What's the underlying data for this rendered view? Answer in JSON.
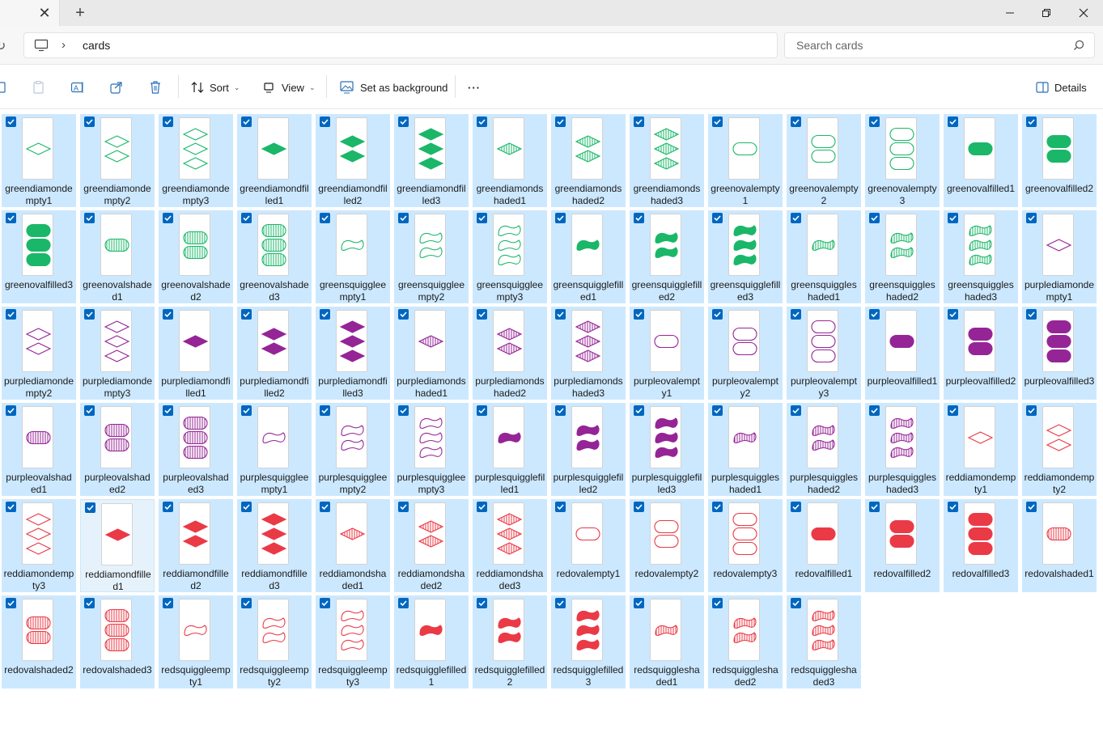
{
  "window": {
    "new_tab_label": "+"
  },
  "address": {
    "crumb": "cards",
    "search_placeholder": "Search cards"
  },
  "toolbar": {
    "sort_label": "Sort",
    "view_label": "View",
    "background_label": "Set as background",
    "more_label": "···",
    "details_label": "Details"
  },
  "colors": {
    "green": "#1bb769",
    "purple": "#952596",
    "red": "#ea3a46",
    "selection": "#cce8ff",
    "checkbox": "#0067c0"
  },
  "files": [
    {
      "name": "greendiamondempty1",
      "color": "green",
      "shape": "diamond",
      "fill": "empty",
      "count": 1
    },
    {
      "name": "greendiamondempty2",
      "color": "green",
      "shape": "diamond",
      "fill": "empty",
      "count": 2
    },
    {
      "name": "greendiamondempty3",
      "color": "green",
      "shape": "diamond",
      "fill": "empty",
      "count": 3
    },
    {
      "name": "greendiamondfilled1",
      "color": "green",
      "shape": "diamond",
      "fill": "filled",
      "count": 1
    },
    {
      "name": "greendiamondfilled2",
      "color": "green",
      "shape": "diamond",
      "fill": "filled",
      "count": 2
    },
    {
      "name": "greendiamondfilled3",
      "color": "green",
      "shape": "diamond",
      "fill": "filled",
      "count": 3
    },
    {
      "name": "greendiamondshaded1",
      "color": "green",
      "shape": "diamond",
      "fill": "shaded",
      "count": 1
    },
    {
      "name": "greendiamondshaded2",
      "color": "green",
      "shape": "diamond",
      "fill": "shaded",
      "count": 2
    },
    {
      "name": "greendiamondshaded3",
      "color": "green",
      "shape": "diamond",
      "fill": "shaded",
      "count": 3
    },
    {
      "name": "greenovalempty1",
      "color": "green",
      "shape": "oval",
      "fill": "empty",
      "count": 1
    },
    {
      "name": "greenovalempty2",
      "color": "green",
      "shape": "oval",
      "fill": "empty",
      "count": 2
    },
    {
      "name": "greenovalempty3",
      "color": "green",
      "shape": "oval",
      "fill": "empty",
      "count": 3
    },
    {
      "name": "greenovalfilled1",
      "color": "green",
      "shape": "oval",
      "fill": "filled",
      "count": 1
    },
    {
      "name": "greenovalfilled2",
      "color": "green",
      "shape": "oval",
      "fill": "filled",
      "count": 2
    },
    {
      "name": "greenovalfilled3",
      "color": "green",
      "shape": "oval",
      "fill": "filled",
      "count": 3
    },
    {
      "name": "greenovalshaded1",
      "color": "green",
      "shape": "oval",
      "fill": "shaded",
      "count": 1
    },
    {
      "name": "greenovalshaded2",
      "color": "green",
      "shape": "oval",
      "fill": "shaded",
      "count": 2
    },
    {
      "name": "greenovalshaded3",
      "color": "green",
      "shape": "oval",
      "fill": "shaded",
      "count": 3
    },
    {
      "name": "greensquiggleempty1",
      "color": "green",
      "shape": "squiggle",
      "fill": "empty",
      "count": 1
    },
    {
      "name": "greensquiggleempty2",
      "color": "green",
      "shape": "squiggle",
      "fill": "empty",
      "count": 2
    },
    {
      "name": "greensquiggleempty3",
      "color": "green",
      "shape": "squiggle",
      "fill": "empty",
      "count": 3
    },
    {
      "name": "greensquigglefilled1",
      "color": "green",
      "shape": "squiggle",
      "fill": "filled",
      "count": 1
    },
    {
      "name": "greensquigglefilled2",
      "color": "green",
      "shape": "squiggle",
      "fill": "filled",
      "count": 2
    },
    {
      "name": "greensquigglefilled3",
      "color": "green",
      "shape": "squiggle",
      "fill": "filled",
      "count": 3
    },
    {
      "name": "greensquiggleshaded1",
      "color": "green",
      "shape": "squiggle",
      "fill": "shaded",
      "count": 1
    },
    {
      "name": "greensquiggleshaded2",
      "color": "green",
      "shape": "squiggle",
      "fill": "shaded",
      "count": 2
    },
    {
      "name": "greensquiggleshaded3",
      "color": "green",
      "shape": "squiggle",
      "fill": "shaded",
      "count": 3
    },
    {
      "name": "purplediamondempty1",
      "color": "purple",
      "shape": "diamond",
      "fill": "empty",
      "count": 1
    },
    {
      "name": "purplediamondempty2",
      "color": "purple",
      "shape": "diamond",
      "fill": "empty",
      "count": 2
    },
    {
      "name": "purplediamondempty3",
      "color": "purple",
      "shape": "diamond",
      "fill": "empty",
      "count": 3
    },
    {
      "name": "purplediamondfilled1",
      "color": "purple",
      "shape": "diamond",
      "fill": "filled",
      "count": 1
    },
    {
      "name": "purplediamondfilled2",
      "color": "purple",
      "shape": "diamond",
      "fill": "filled",
      "count": 2
    },
    {
      "name": "purplediamondfilled3",
      "color": "purple",
      "shape": "diamond",
      "fill": "filled",
      "count": 3
    },
    {
      "name": "purplediamondshaded1",
      "color": "purple",
      "shape": "diamond",
      "fill": "shaded",
      "count": 1
    },
    {
      "name": "purplediamondshaded2",
      "color": "purple",
      "shape": "diamond",
      "fill": "shaded",
      "count": 2
    },
    {
      "name": "purplediamondshaded3",
      "color": "purple",
      "shape": "diamond",
      "fill": "shaded",
      "count": 3
    },
    {
      "name": "purpleovalempty1",
      "color": "purple",
      "shape": "oval",
      "fill": "empty",
      "count": 1
    },
    {
      "name": "purpleovalempty2",
      "color": "purple",
      "shape": "oval",
      "fill": "empty",
      "count": 2
    },
    {
      "name": "purpleovalempty3",
      "color": "purple",
      "shape": "oval",
      "fill": "empty",
      "count": 3
    },
    {
      "name": "purpleovalfilled1",
      "color": "purple",
      "shape": "oval",
      "fill": "filled",
      "count": 1
    },
    {
      "name": "purpleovalfilled2",
      "color": "purple",
      "shape": "oval",
      "fill": "filled",
      "count": 2
    },
    {
      "name": "purpleovalfilled3",
      "color": "purple",
      "shape": "oval",
      "fill": "filled",
      "count": 3
    },
    {
      "name": "purpleovalshaded1",
      "color": "purple",
      "shape": "oval",
      "fill": "shaded",
      "count": 1
    },
    {
      "name": "purpleovalshaded2",
      "color": "purple",
      "shape": "oval",
      "fill": "shaded",
      "count": 2
    },
    {
      "name": "purpleovalshaded3",
      "color": "purple",
      "shape": "oval",
      "fill": "shaded",
      "count": 3
    },
    {
      "name": "purplesquiggleempty1",
      "color": "purple",
      "shape": "squiggle",
      "fill": "empty",
      "count": 1
    },
    {
      "name": "purplesquiggleempty2",
      "color": "purple",
      "shape": "squiggle",
      "fill": "empty",
      "count": 2
    },
    {
      "name": "purplesquiggleempty3",
      "color": "purple",
      "shape": "squiggle",
      "fill": "empty",
      "count": 3
    },
    {
      "name": "purplesquigglefilled1",
      "color": "purple",
      "shape": "squiggle",
      "fill": "filled",
      "count": 1
    },
    {
      "name": "purplesquigglefilled2",
      "color": "purple",
      "shape": "squiggle",
      "fill": "filled",
      "count": 2
    },
    {
      "name": "purplesquigglefilled3",
      "color": "purple",
      "shape": "squiggle",
      "fill": "filled",
      "count": 3
    },
    {
      "name": "purplesquiggleshaded1",
      "color": "purple",
      "shape": "squiggle",
      "fill": "shaded",
      "count": 1
    },
    {
      "name": "purplesquiggleshaded2",
      "color": "purple",
      "shape": "squiggle",
      "fill": "shaded",
      "count": 2
    },
    {
      "name": "purplesquiggleshaded3",
      "color": "purple",
      "shape": "squiggle",
      "fill": "shaded",
      "count": 3
    },
    {
      "name": "reddiamondempty1",
      "color": "red",
      "shape": "diamond",
      "fill": "empty",
      "count": 1
    },
    {
      "name": "reddiamondempty2",
      "color": "red",
      "shape": "diamond",
      "fill": "empty",
      "count": 2
    },
    {
      "name": "reddiamondempty3",
      "color": "red",
      "shape": "diamond",
      "fill": "empty",
      "count": 3
    },
    {
      "name": "reddiamondfilled1",
      "color": "red",
      "shape": "diamond",
      "fill": "filled",
      "count": 1,
      "plain": true
    },
    {
      "name": "reddiamondfilled2",
      "color": "red",
      "shape": "diamond",
      "fill": "filled",
      "count": 2
    },
    {
      "name": "reddiamondfilled3",
      "color": "red",
      "shape": "diamond",
      "fill": "filled",
      "count": 3
    },
    {
      "name": "reddiamondshaded1",
      "color": "red",
      "shape": "diamond",
      "fill": "shaded",
      "count": 1
    },
    {
      "name": "reddiamondshaded2",
      "color": "red",
      "shape": "diamond",
      "fill": "shaded",
      "count": 2
    },
    {
      "name": "reddiamondshaded3",
      "color": "red",
      "shape": "diamond",
      "fill": "shaded",
      "count": 3
    },
    {
      "name": "redovalempty1",
      "color": "red",
      "shape": "oval",
      "fill": "empty",
      "count": 1
    },
    {
      "name": "redovalempty2",
      "color": "red",
      "shape": "oval",
      "fill": "empty",
      "count": 2
    },
    {
      "name": "redovalempty3",
      "color": "red",
      "shape": "oval",
      "fill": "empty",
      "count": 3
    },
    {
      "name": "redovalfilled1",
      "color": "red",
      "shape": "oval",
      "fill": "filled",
      "count": 1
    },
    {
      "name": "redovalfilled2",
      "color": "red",
      "shape": "oval",
      "fill": "filled",
      "count": 2
    },
    {
      "name": "redovalfilled3",
      "color": "red",
      "shape": "oval",
      "fill": "filled",
      "count": 3
    },
    {
      "name": "redovalshaded1",
      "color": "red",
      "shape": "oval",
      "fill": "shaded",
      "count": 1
    },
    {
      "name": "redovalshaded2",
      "color": "red",
      "shape": "oval",
      "fill": "shaded",
      "count": 2
    },
    {
      "name": "redovalshaded3",
      "color": "red",
      "shape": "oval",
      "fill": "shaded",
      "count": 3
    },
    {
      "name": "redsquiggleempty1",
      "color": "red",
      "shape": "squiggle",
      "fill": "empty",
      "count": 1
    },
    {
      "name": "redsquiggleempty2",
      "color": "red",
      "shape": "squiggle",
      "fill": "empty",
      "count": 2
    },
    {
      "name": "redsquiggleempty3",
      "color": "red",
      "shape": "squiggle",
      "fill": "empty",
      "count": 3
    },
    {
      "name": "redsquigglefilled1",
      "color": "red",
      "shape": "squiggle",
      "fill": "filled",
      "count": 1
    },
    {
      "name": "redsquigglefilled2",
      "color": "red",
      "shape": "squiggle",
      "fill": "filled",
      "count": 2
    },
    {
      "name": "redsquigglefilled3",
      "color": "red",
      "shape": "squiggle",
      "fill": "filled",
      "count": 3
    },
    {
      "name": "redsquiggleshaded1",
      "color": "red",
      "shape": "squiggle",
      "fill": "shaded",
      "count": 1
    },
    {
      "name": "redsquiggleshaded2",
      "color": "red",
      "shape": "squiggle",
      "fill": "shaded",
      "count": 2
    },
    {
      "name": "redsquiggleshaded3",
      "color": "red",
      "shape": "squiggle",
      "fill": "shaded",
      "count": 3
    }
  ]
}
